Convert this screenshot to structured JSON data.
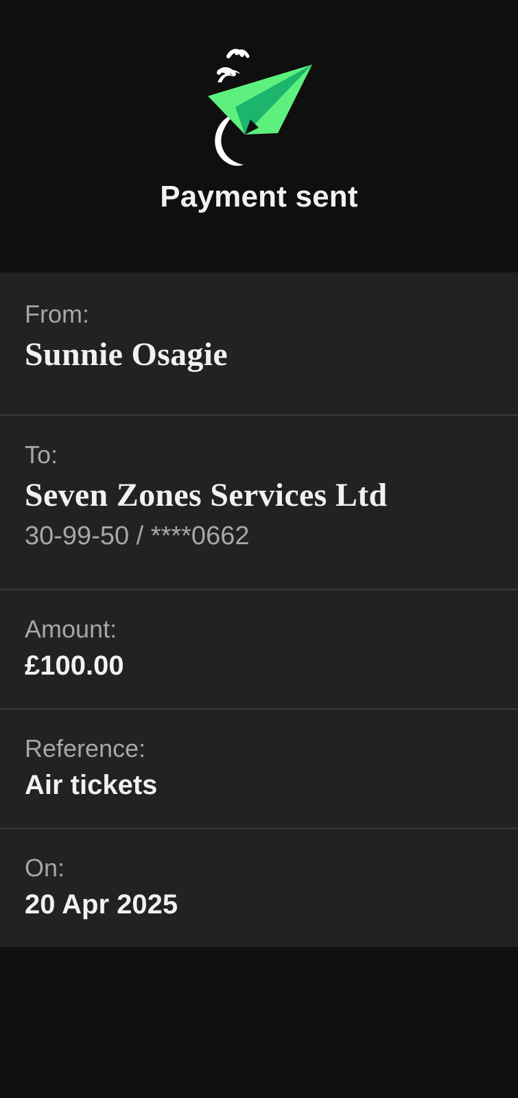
{
  "header": {
    "title": "Payment sent",
    "icon": "paper-plane-icon",
    "colors": {
      "plane_light": "#5ef07f",
      "plane_dark": "#1db56b",
      "birds": "#ffffff"
    }
  },
  "details": {
    "from": {
      "label": "From:",
      "value": "Sunnie Osagie"
    },
    "to": {
      "label": "To:",
      "value": "Seven Zones Services Ltd",
      "account": "30-99-50 / ****0662"
    },
    "amount": {
      "label": "Amount:",
      "value": "£100.00"
    },
    "reference": {
      "label": "Reference:",
      "value": "Air tickets"
    },
    "on": {
      "label": "On:",
      "value": "20 Apr 2025"
    }
  },
  "colors": {
    "background": "#0f0f0f",
    "panel": "#222222",
    "divider": "#3a3a3a",
    "text_primary": "#f1f1f1",
    "text_secondary": "#a7a7a7"
  }
}
